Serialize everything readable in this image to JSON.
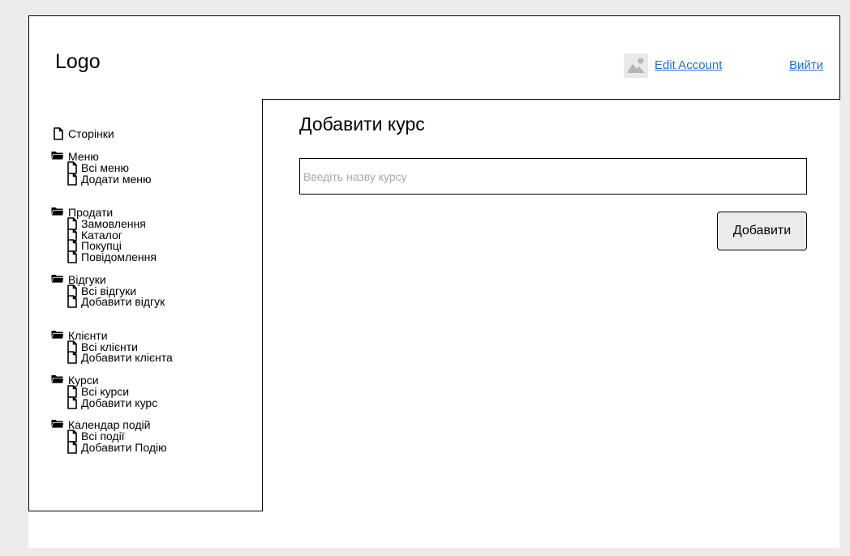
{
  "header": {
    "logo": "Logo",
    "avatar_icon": "image-placeholder-icon",
    "edit_account_label": "Edit Account",
    "logout_label": "Вийти",
    "link_color": "#1f6fd6"
  },
  "sidebar": {
    "pages_label": "Сторінки",
    "groups": [
      {
        "label": "Меню",
        "items": [
          "Всі меню",
          "Додати меню"
        ]
      },
      {
        "label": "Продати",
        "items": [
          "Замовлення",
          "Каталог",
          "Покупці",
          "Повідомлення"
        ]
      },
      {
        "label": "Відгуки",
        "items": [
          "Всі відгуки",
          "Добавити відгук"
        ]
      },
      {
        "label": "Клієнти",
        "items": [
          "Всі клієнти",
          "Добавити клієнта"
        ]
      },
      {
        "label": "Курси",
        "items": [
          "Всі курси",
          "Добавити курс"
        ]
      },
      {
        "label": "Календар подій",
        "items": [
          "Всі події",
          "Добавити Подію"
        ]
      }
    ]
  },
  "main": {
    "title": "Добавити курс",
    "course_input": {
      "placeholder": "Введіть назву курсу",
      "value": ""
    },
    "add_button_label": "Добавити"
  }
}
